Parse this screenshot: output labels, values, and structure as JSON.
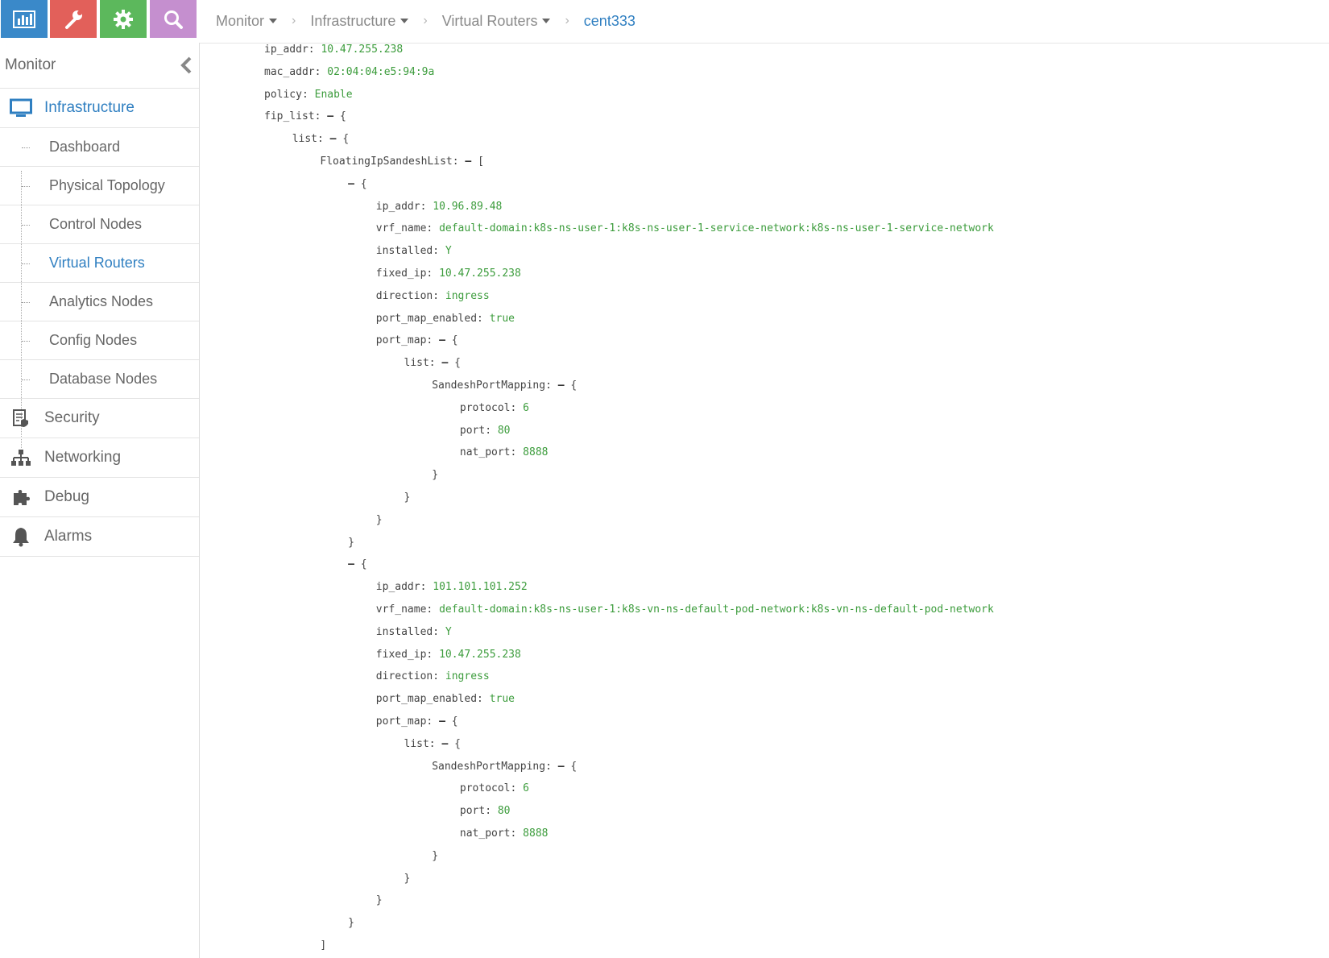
{
  "toolbar": {
    "buttons": [
      {
        "name": "monitor",
        "icon": "bar-chart-icon",
        "color": "#3a89c9"
      },
      {
        "name": "configure",
        "icon": "wrench-icon",
        "color": "#e2605a"
      },
      {
        "name": "settings",
        "icon": "gear-icon",
        "color": "#5cb85c"
      },
      {
        "name": "query",
        "icon": "search-icon",
        "color": "#c58fcf"
      }
    ]
  },
  "breadcrumb": {
    "items": [
      "Monitor",
      "Infrastructure",
      "Virtual Routers"
    ],
    "current": "cent333"
  },
  "sidebar": {
    "title": "Monitor",
    "infrastructure": "Infrastructure",
    "sub_items": [
      "Dashboard",
      "Physical Topology",
      "Control Nodes",
      "Virtual Routers",
      "Analytics Nodes",
      "Config Nodes",
      "Database Nodes"
    ],
    "active_sub": "Virtual Routers",
    "main_items": [
      {
        "label": "Security",
        "icon": "shield-document-icon"
      },
      {
        "label": "Networking",
        "icon": "sitemap-icon"
      },
      {
        "label": "Debug",
        "icon": "puzzle-icon"
      },
      {
        "label": "Alarms",
        "icon": "bell-icon"
      }
    ]
  },
  "json_lines": [
    {
      "indent": 0,
      "key": "ip_addr:",
      "value": "10.47.255.238"
    },
    {
      "indent": 0,
      "key": "mac_addr:",
      "value": "02:04:04:e5:94:9a"
    },
    {
      "indent": 0,
      "key": "policy:",
      "value": "Enable"
    },
    {
      "indent": 0,
      "key": "fip_list:",
      "toggle": "–",
      "brace": "{"
    },
    {
      "indent": 1,
      "key": "list:",
      "toggle": "–",
      "brace": "{"
    },
    {
      "indent": 2,
      "key": "FloatingIpSandeshList:",
      "toggle": "–",
      "brace": "["
    },
    {
      "indent": 3,
      "toggle": "–",
      "brace": "{"
    },
    {
      "indent": 4,
      "key": "ip_addr:",
      "value": "10.96.89.48"
    },
    {
      "indent": 4,
      "key": "vrf_name:",
      "value": "default-domain:k8s-ns-user-1:k8s-ns-user-1-service-network:k8s-ns-user-1-service-network"
    },
    {
      "indent": 4,
      "key": "installed:",
      "value": "Y"
    },
    {
      "indent": 4,
      "key": "fixed_ip:",
      "value": "10.47.255.238"
    },
    {
      "indent": 4,
      "key": "direction:",
      "value": "ingress"
    },
    {
      "indent": 4,
      "key": "port_map_enabled:",
      "value": "true"
    },
    {
      "indent": 4,
      "key": "port_map:",
      "toggle": "–",
      "brace": "{"
    },
    {
      "indent": 5,
      "key": "list:",
      "toggle": "–",
      "brace": "{"
    },
    {
      "indent": 6,
      "key": "SandeshPortMapping:",
      "toggle": "–",
      "brace": "{"
    },
    {
      "indent": 7,
      "key": "protocol:",
      "value": "6"
    },
    {
      "indent": 7,
      "key": "port:",
      "value": "80"
    },
    {
      "indent": 7,
      "key": "nat_port:",
      "value": "8888"
    },
    {
      "indent": 6,
      "brace": "}"
    },
    {
      "indent": 5,
      "brace": "}"
    },
    {
      "indent": 4,
      "brace": "}"
    },
    {
      "indent": 3,
      "brace": "}"
    },
    {
      "indent": 3,
      "toggle": "–",
      "brace": "{"
    },
    {
      "indent": 4,
      "key": "ip_addr:",
      "value": "101.101.101.252"
    },
    {
      "indent": 4,
      "key": "vrf_name:",
      "value": "default-domain:k8s-ns-user-1:k8s-vn-ns-default-pod-network:k8s-vn-ns-default-pod-network"
    },
    {
      "indent": 4,
      "key": "installed:",
      "value": "Y"
    },
    {
      "indent": 4,
      "key": "fixed_ip:",
      "value": "10.47.255.238"
    },
    {
      "indent": 4,
      "key": "direction:",
      "value": "ingress"
    },
    {
      "indent": 4,
      "key": "port_map_enabled:",
      "value": "true"
    },
    {
      "indent": 4,
      "key": "port_map:",
      "toggle": "–",
      "brace": "{"
    },
    {
      "indent": 5,
      "key": "list:",
      "toggle": "–",
      "brace": "{"
    },
    {
      "indent": 6,
      "key": "SandeshPortMapping:",
      "toggle": "–",
      "brace": "{"
    },
    {
      "indent": 7,
      "key": "protocol:",
      "value": "6"
    },
    {
      "indent": 7,
      "key": "port:",
      "value": "80"
    },
    {
      "indent": 7,
      "key": "nat_port:",
      "value": "8888"
    },
    {
      "indent": 6,
      "brace": "}"
    },
    {
      "indent": 5,
      "brace": "}"
    },
    {
      "indent": 4,
      "brace": "}"
    },
    {
      "indent": 3,
      "brace": "}"
    },
    {
      "indent": 2,
      "brace": "]"
    }
  ]
}
